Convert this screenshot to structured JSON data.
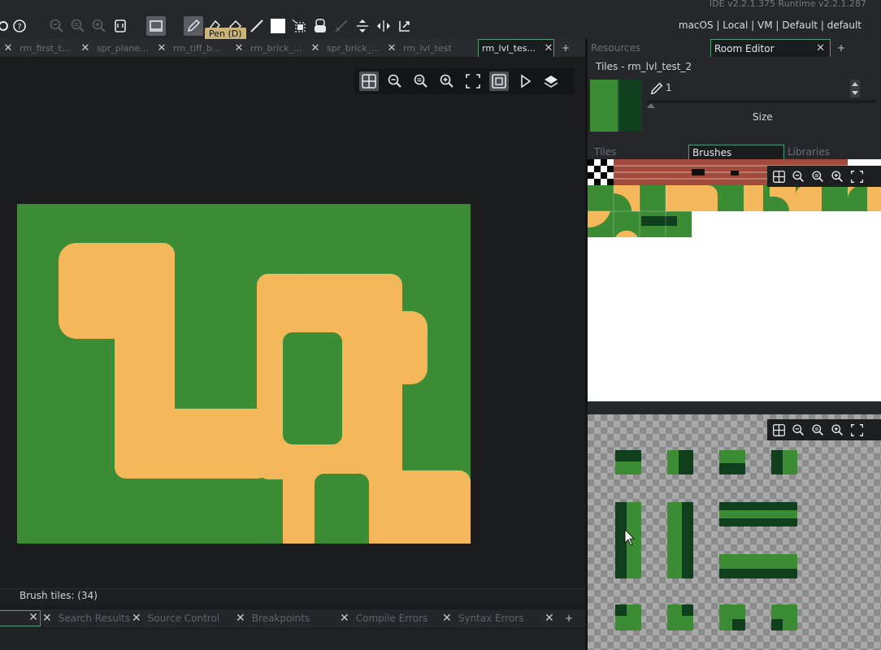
{
  "app": {
    "version": "IDE v2.2.1.375  Runtime v2.2.1.287",
    "targets": "macOS | Local | VM | Default | default"
  },
  "toolbar": {
    "tooltip": "Pen (D)",
    "tools": [
      "help-icon",
      "zoom-out-icon",
      "zoom-reset-icon",
      "zoom-in-icon",
      "gamepad-icon",
      "monitor-icon",
      "pen-icon",
      "eraser-icon",
      "fill-icon",
      "line-icon",
      "rectangle-icon",
      "select-icon",
      "flip-icon",
      "mirror-icon",
      "rotate-icon",
      "scale-icon",
      "horizontal-flip-icon",
      "vertical-flip-icon"
    ]
  },
  "editor_tabs": [
    {
      "label": "rm_first_t..."
    },
    {
      "label": "spr_plane..."
    },
    {
      "label": "rm_tiff_b..."
    },
    {
      "label": "rm_brick_..."
    },
    {
      "label": "spr_brick_..."
    },
    {
      "label": "rm_lvl_test"
    },
    {
      "label": "rm_lvl_tes..."
    }
  ],
  "statusbar": {
    "text": "Brush tiles: (34)"
  },
  "bottom_tabs": [
    {
      "label": "Search Results"
    },
    {
      "label": "Source Control"
    },
    {
      "label": "Breakpoints"
    },
    {
      "label": "Compile Errors"
    },
    {
      "label": "Syntax Errors"
    }
  ],
  "right_panel": {
    "tabs": [
      {
        "label": "Resources"
      },
      {
        "label": "Room Editor"
      }
    ],
    "title": "Tiles - rm_lvl_test_2",
    "brush_value": "1",
    "size_label": "Size",
    "library_tabs": [
      {
        "label": "Tiles"
      },
      {
        "label": "Brushes"
      },
      {
        "label": "Libraries"
      }
    ]
  },
  "colors": {
    "accent": "#4e9d7b",
    "grass": "#3b8c35",
    "sand": "#f4b75a",
    "dark_grass": "#103f1d"
  }
}
